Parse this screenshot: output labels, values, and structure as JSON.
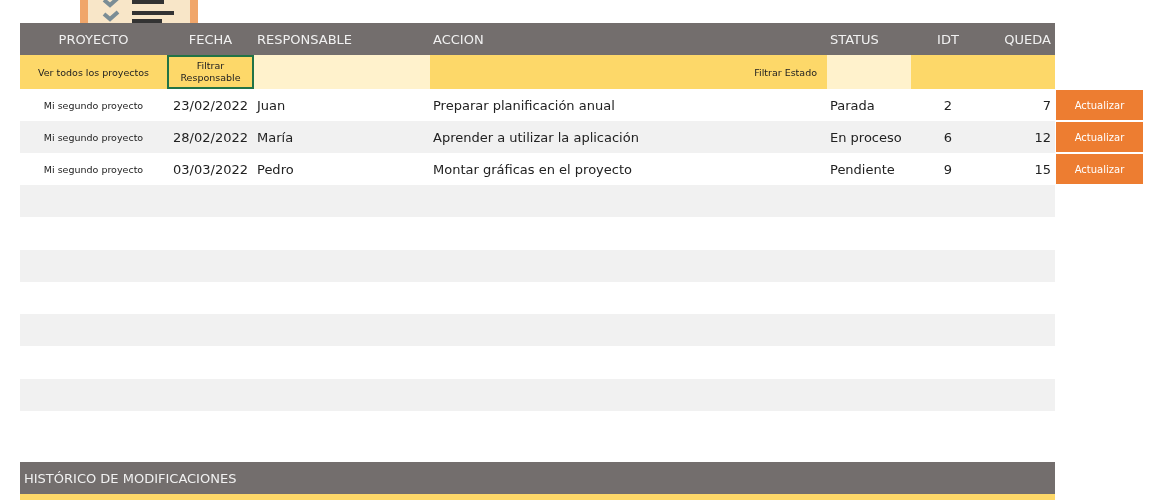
{
  "table": {
    "columns": [
      "PROYECTO",
      "FECHA",
      "RESPONSABLE",
      "ACCION",
      "STATUS",
      "IDT",
      "QUEDA"
    ],
    "filters": [
      {
        "label": "Ver todos los proyectos",
        "selected": false
      },
      {
        "label": "Filtrar Responsable",
        "selected": true
      },
      {
        "label": "Filtrar Estado",
        "selected": false
      }
    ],
    "rows": [
      {
        "proyecto": "Mi segundo proyecto",
        "fecha": "23/02/2022",
        "responsable": "Juan",
        "accion": "Preparar planificación anual",
        "status": "Parada",
        "idt": "2",
        "queda": "7",
        "button": "Actualizar"
      },
      {
        "proyecto": "Mi segundo proyecto",
        "fecha": "28/02/2022",
        "responsable": "María",
        "accion": "Aprender a utilizar la aplicación",
        "status": "En proceso",
        "idt": "6",
        "queda": "12",
        "button": "Actualizar"
      },
      {
        "proyecto": "Mi segundo proyecto",
        "fecha": "03/03/2022",
        "responsable": "Pedro",
        "accion": "Montar gráficas en el proyecto",
        "status": "Pendiente",
        "idt": "9",
        "queda": "15",
        "button": "Actualizar"
      }
    ]
  },
  "history": {
    "title": "HISTÓRICO DE MODIFICACIONES"
  }
}
